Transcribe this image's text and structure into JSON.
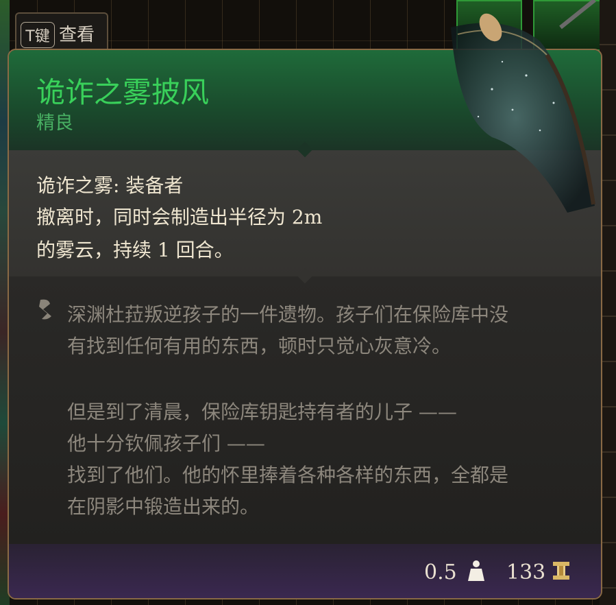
{
  "hint": {
    "key": "T键",
    "label": "查看"
  },
  "item": {
    "name": "诡诈之雾披风",
    "rarity": "精良",
    "name_color": "#39d05a",
    "rarity_color": "#48b063"
  },
  "effect": {
    "lines": [
      "诡诈之雾: 装备者",
      "撤离时，同时会制造出半径为 2m",
      "的雾云，持续 1 回合。"
    ]
  },
  "lore": {
    "icon": "scroll-quill-icon",
    "lines": [
      "深渊杜菈叛逆孩子的一件遗物。孩子们在保险库中没",
      "有找到任何有用的东西，顿时只觉心灰意冷。",
      "",
      "但是到了清晨，保险库钥匙持有者的儿子 ——",
      "他十分钦佩孩子们 ——",
      "找到了他们。他的怀里捧着各种各样的东西，全都是",
      "在阴影中锻造出来的。"
    ]
  },
  "footer": {
    "weight": "0.5",
    "weight_icon": "weight-icon",
    "price": "133",
    "price_icon": "gold-coin-icon"
  }
}
